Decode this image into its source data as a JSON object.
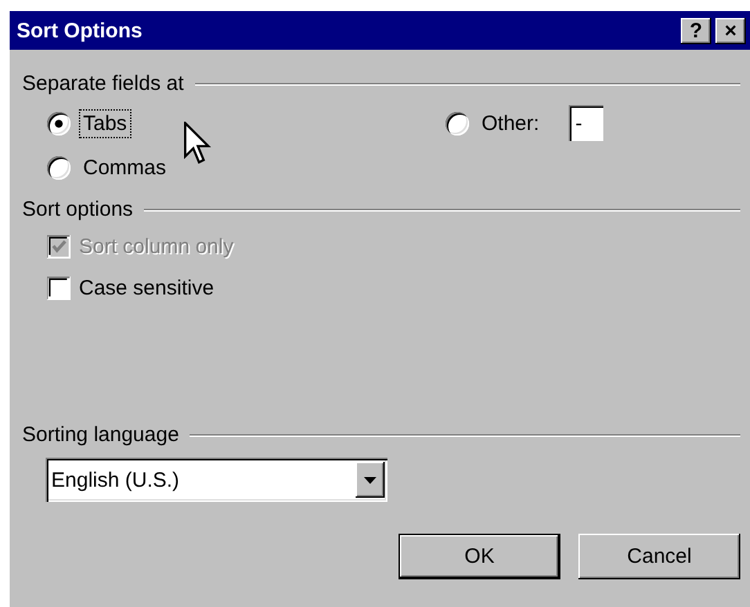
{
  "window": {
    "title": "Sort Options",
    "help_button": "?",
    "close_button": "×"
  },
  "separate_fields": {
    "heading": "Separate fields at",
    "options": [
      {
        "label": "Tabs",
        "selected": true,
        "focused": true
      },
      {
        "label": "Commas",
        "selected": false,
        "focused": false
      },
      {
        "label": "Other:",
        "selected": false,
        "focused": false
      }
    ],
    "other_value": "-"
  },
  "sort_options": {
    "heading": "Sort options",
    "checkboxes": [
      {
        "label": "Sort column only",
        "checked": true,
        "disabled": true
      },
      {
        "label": "Case sensitive",
        "checked": false,
        "disabled": false
      }
    ]
  },
  "sorting_language": {
    "heading": "Sorting language",
    "value": "English (U.S.)"
  },
  "buttons": [
    {
      "label": "OK",
      "default": true
    },
    {
      "label": "Cancel",
      "default": false
    }
  ]
}
